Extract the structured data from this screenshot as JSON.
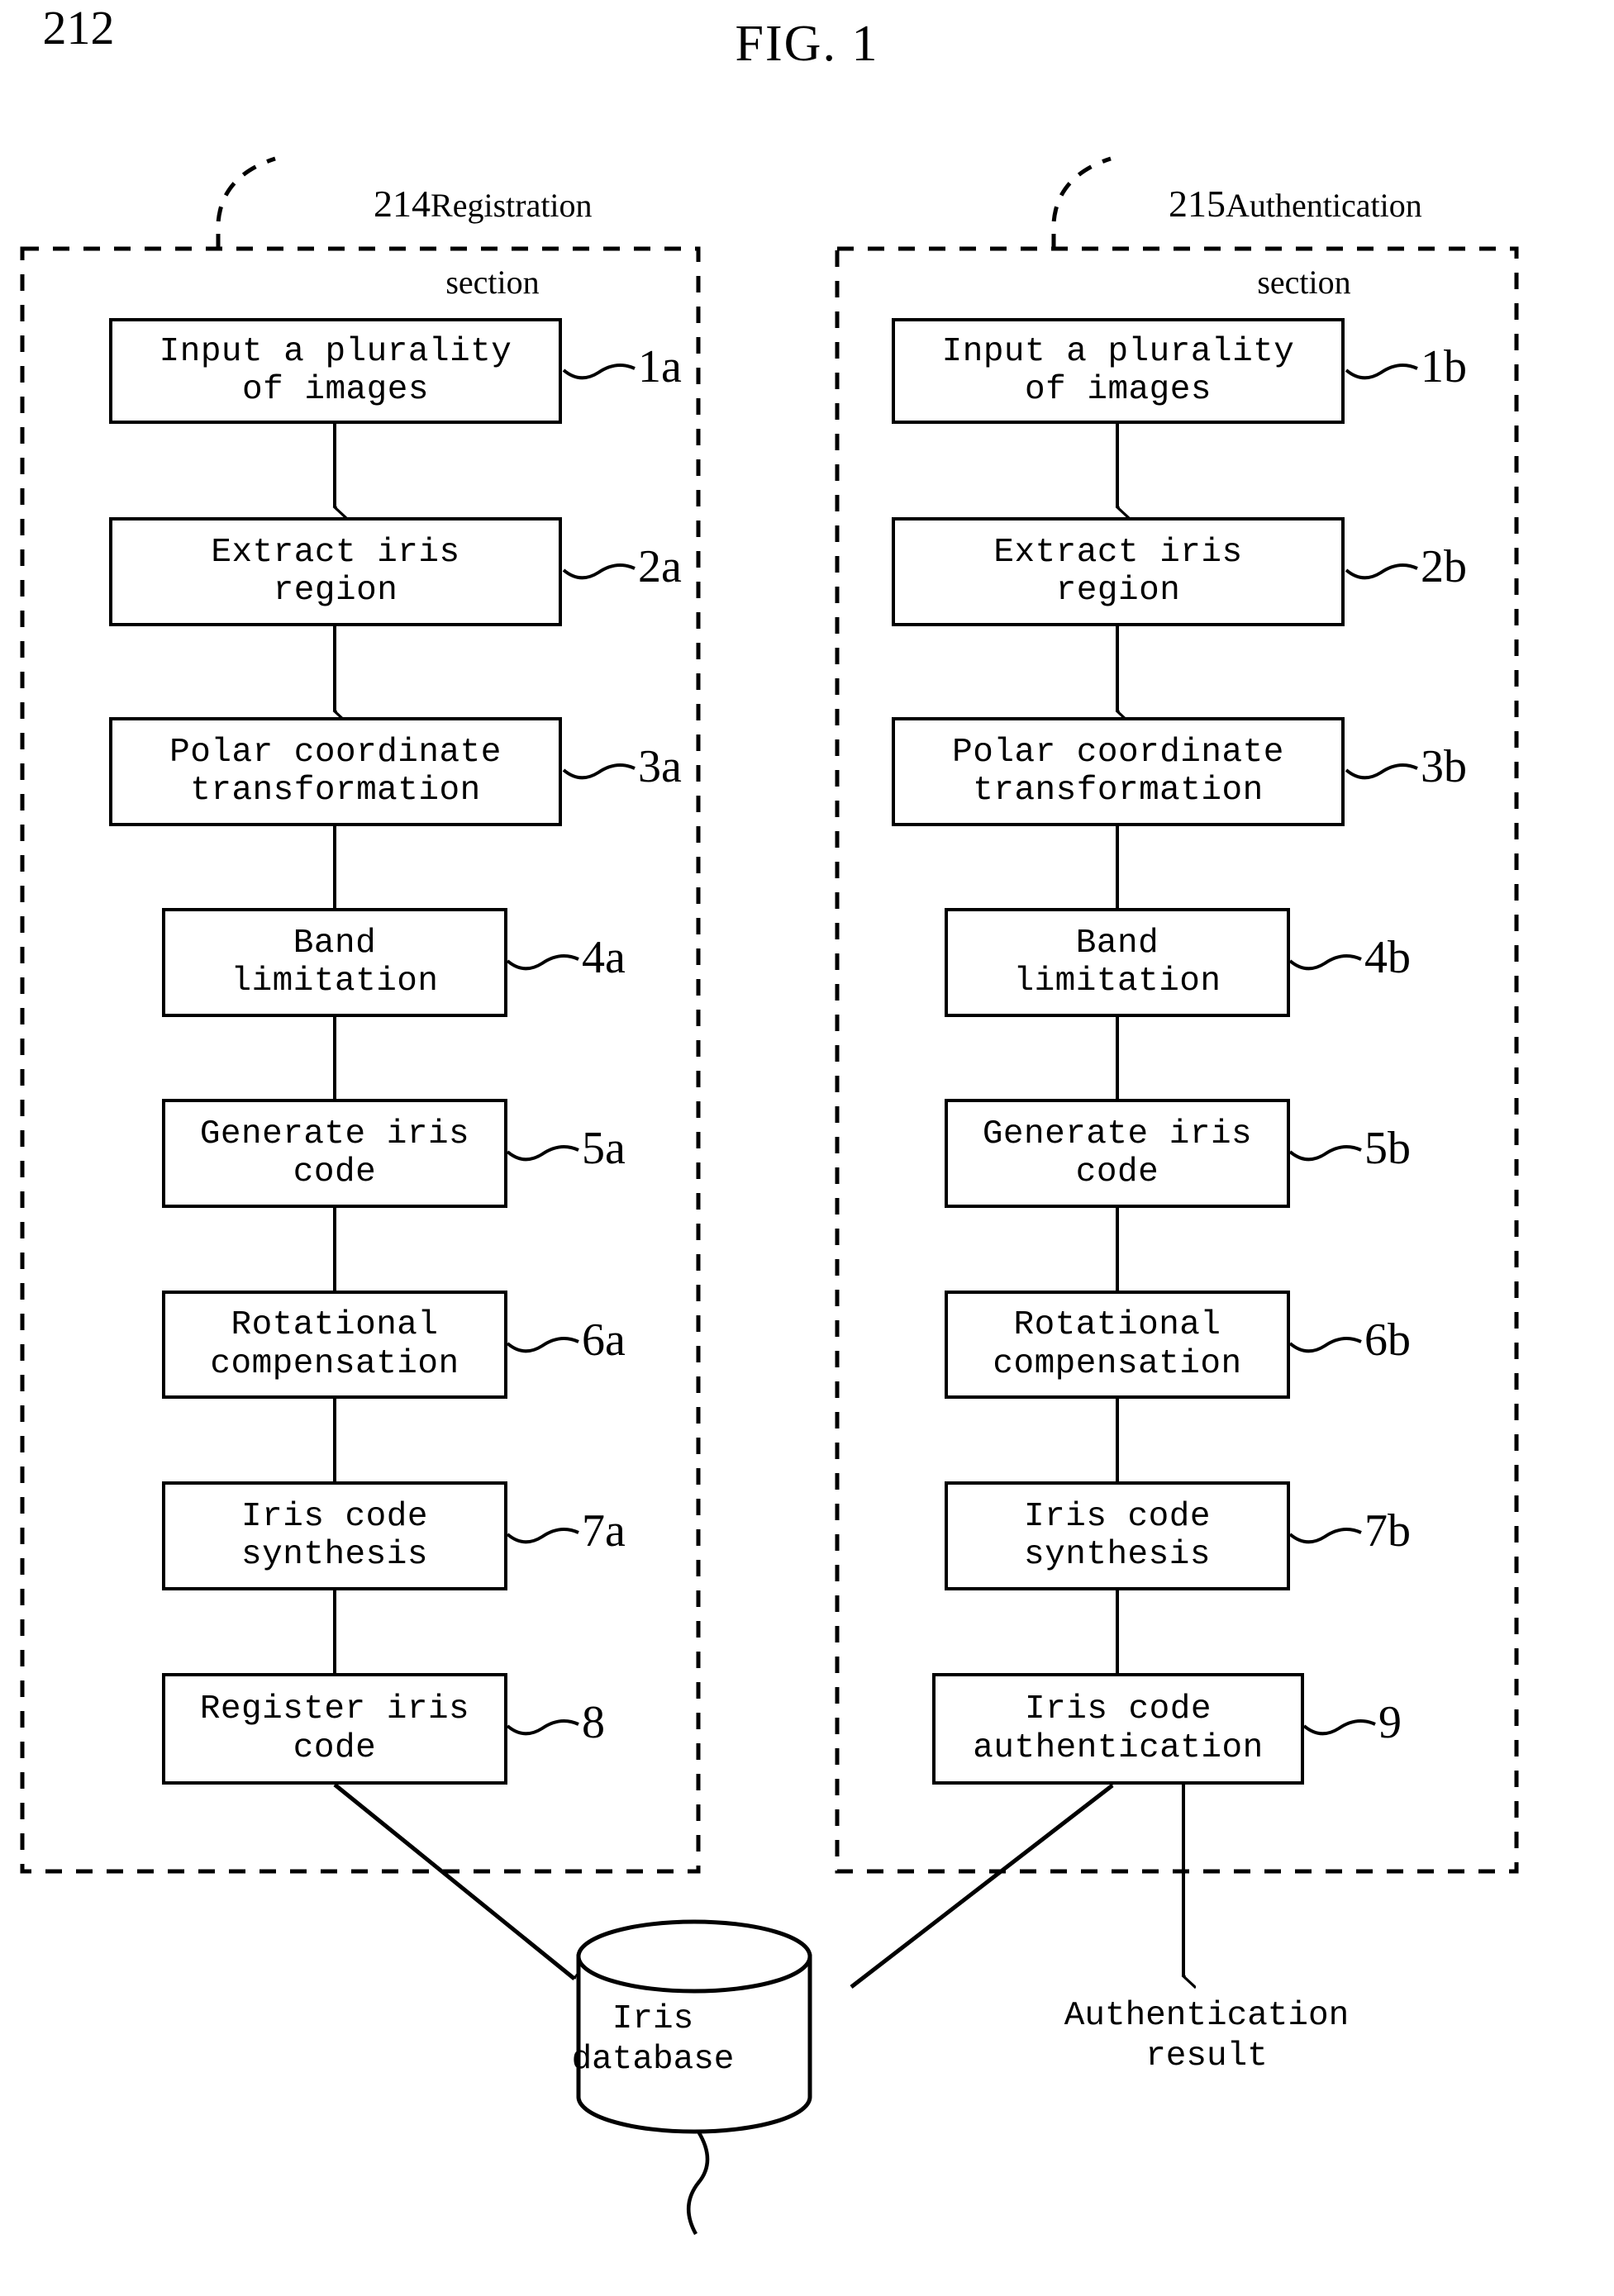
{
  "figure": {
    "title": "FIG. 1"
  },
  "sections": [
    {
      "id": "registration",
      "ref_number": "214",
      "label_line1": "Registration",
      "label_line2": "section"
    },
    {
      "id": "authentication",
      "ref_number": "215",
      "label_line1": "Authentication",
      "label_line2": "section"
    }
  ],
  "registration_steps": [
    {
      "ref": "1a",
      "label": "Input a plurality\nof images"
    },
    {
      "ref": "2a",
      "label": "Extract iris\nregion"
    },
    {
      "ref": "3a",
      "label": "Polar coordinate\ntransformation"
    },
    {
      "ref": "4a",
      "label": "Band\nlimitation"
    },
    {
      "ref": "5a",
      "label": "Generate iris\ncode"
    },
    {
      "ref": "6a",
      "label": "Rotational\ncompensation"
    },
    {
      "ref": "7a",
      "label": "Iris code\nsynthesis"
    },
    {
      "ref": "8",
      "label": "Register iris\ncode"
    }
  ],
  "authentication_steps": [
    {
      "ref": "1b",
      "label": "Input a plurality\nof images"
    },
    {
      "ref": "2b",
      "label": "Extract iris\nregion"
    },
    {
      "ref": "3b",
      "label": "Polar coordinate\ntransformation"
    },
    {
      "ref": "4b",
      "label": "Band\nlimitation"
    },
    {
      "ref": "5b",
      "label": "Generate iris\ncode"
    },
    {
      "ref": "6b",
      "label": "Rotational\ncompensation"
    },
    {
      "ref": "7b",
      "label": "Iris code\nsynthesis"
    },
    {
      "ref": "9",
      "label": "Iris code\nauthentication"
    }
  ],
  "database": {
    "label": "Iris\ndatabase",
    "ref_number": "212"
  },
  "output": {
    "label": "Authentication\nresult"
  },
  "colors": {
    "ink": "#000000",
    "paper": "#ffffff"
  }
}
